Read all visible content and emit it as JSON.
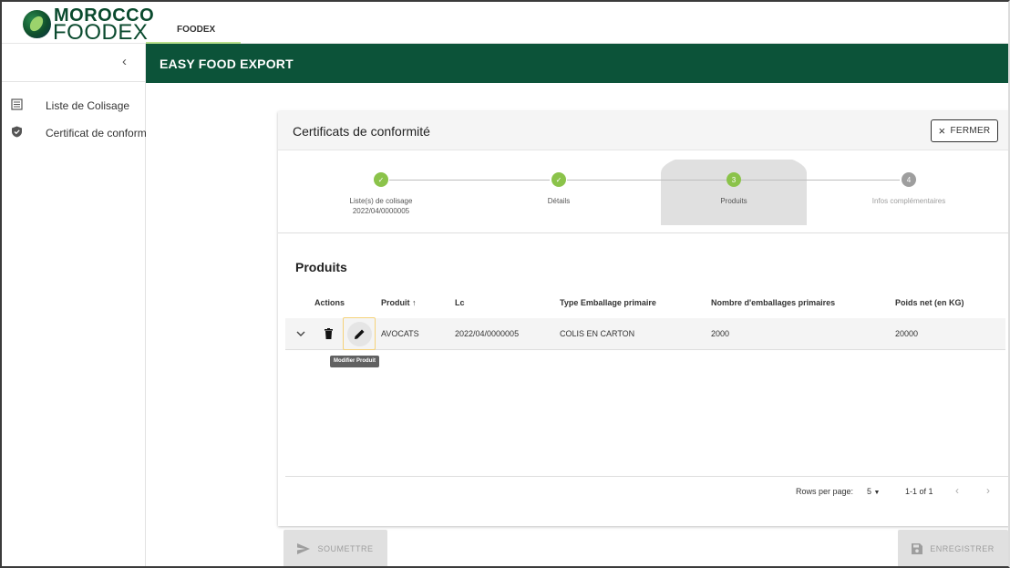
{
  "logo": {
    "line1": "MOROCCO",
    "line2": "FOODEX"
  },
  "top_tab": {
    "label": "FOODEX"
  },
  "sidebar": {
    "collapse_icon": "‹",
    "items": [
      {
        "label": "Liste de Colisage",
        "icon": "list-icon"
      },
      {
        "label": "Certificat de conformité",
        "icon": "shield-check-icon"
      }
    ]
  },
  "banner": {
    "title": "EASY FOOD EXPORT"
  },
  "card": {
    "title": "Certificats de conformité",
    "close_label": "FERMER",
    "close_icon": "×"
  },
  "stepper": {
    "steps": [
      {
        "label": "Liste(s) de colisage",
        "sub": "2022/04/0000005",
        "state": "done",
        "marker": "✓"
      },
      {
        "label": "Détails",
        "sub": "",
        "state": "done",
        "marker": "✓"
      },
      {
        "label": "Produits",
        "sub": "",
        "state": "active",
        "marker": "3"
      },
      {
        "label": "Infos complémentaires",
        "sub": "",
        "state": "todo",
        "marker": "4"
      }
    ]
  },
  "products": {
    "title": "Produits",
    "columns": [
      "Actions",
      "Produit ↑",
      "Lc",
      "Type Emballage primaire",
      "Nombre d'emballages primaires",
      "Poids net (en KG)"
    ],
    "rows": [
      {
        "produit": "AVOCATS",
        "lc": "2022/04/0000005",
        "type": "COLIS EN CARTON",
        "nombre": "2000",
        "poids": "20000"
      }
    ],
    "tooltip": "Modifier Produit",
    "pager": {
      "rows_label": "Rows per page:",
      "rows_value": "5",
      "range": "1-1 of 1"
    }
  },
  "actions": {
    "submit_label": "SOUMETTRE",
    "save_label": "ENREGISTRER"
  },
  "colors": {
    "banner": "#0c5339",
    "step_done": "#8bc34a",
    "step_todo": "#9e9e9e"
  }
}
